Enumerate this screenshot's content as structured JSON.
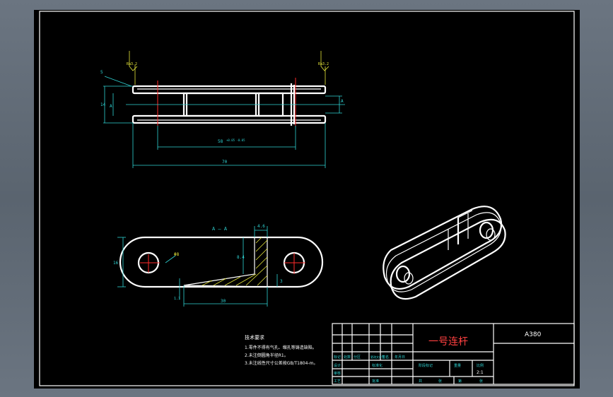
{
  "drawing": {
    "dim_top_width": "70",
    "dim_inner": "58",
    "dim_inner_tol": "+0.05 -0.05",
    "dim_height": "14",
    "dim_left_small": "A",
    "dim_right_small": "A",
    "rough_left": "Ra3.2",
    "rough_right": "Ra3.2",
    "callout_left": "5",
    "section_label": "A — A",
    "dim_section_thk": "4.6",
    "dim_section_h": "8.4",
    "dim_section_w": "30",
    "dim_section_height": "16",
    "dim_slot": "3",
    "dim_bottom_small": "1.1",
    "hole_dia": "Φ8",
    "notes_title": "技术要求",
    "notes": [
      "1.零件不得有气孔、缩孔等铸造缺陷。",
      "2.未注倒圆角半径R1。",
      "3.未注线性尺寸公差按GB/T1804-m。"
    ]
  },
  "title_block": {
    "part_name": "一号连杆",
    "drawing_no": "A380",
    "scale": "2:1",
    "labels": {
      "mark": "标记",
      "count": "处数",
      "zone": "分区",
      "change_no": "更改文件号",
      "sign": "签名",
      "date": "年月日",
      "design": "设计",
      "standardize": "标准化",
      "review": "审核",
      "process": "工艺",
      "approve": "批准",
      "stage": "阶段标记",
      "weight": "重量",
      "ratio": "比例",
      "total": "共",
      "sheet": "第",
      "page": "张"
    }
  }
}
